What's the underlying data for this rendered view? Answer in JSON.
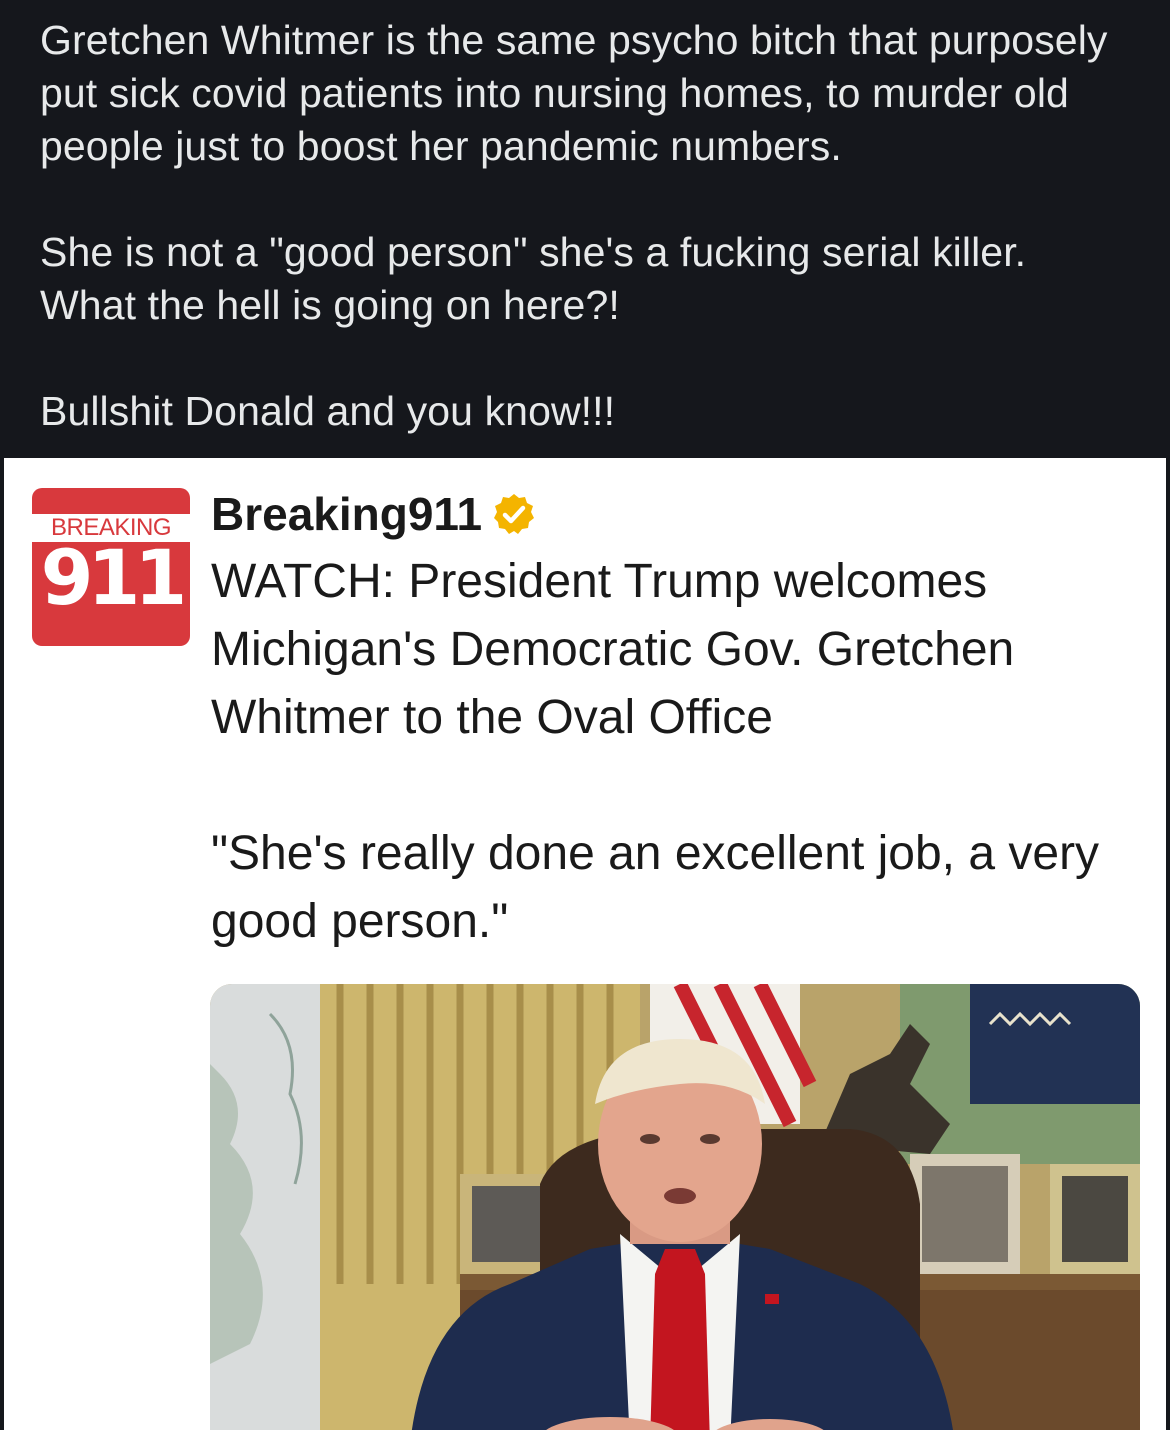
{
  "post": {
    "paragraph1": "Gretchen Whitmer is the same psycho bitch that purposely put sick covid patients into nursing homes, to murder old people just to boost her pandemic numbers.",
    "paragraph2_line1": "She is not a \"good person\" she's a fucking serial killer.",
    "paragraph2_line2": "What the hell is going on here?!",
    "paragraph3": "Bullshit Donald and you know!!!"
  },
  "embedded_tweet": {
    "logo_top_text": "BREAKING",
    "logo_number": "911",
    "handle": "Breaking911",
    "verified_icon": "verified-badge-icon",
    "verified_color": "#f4b400",
    "headline": "WATCH: President Trump welcomes Michigan's Democratic Gov. Gretchen Whitmer to the Oval Office",
    "quote": "\"She's really done an excellent job, a very good person.\"",
    "photo_icon": "oval-office-photo"
  },
  "colors": {
    "page_background": "#15171c",
    "post_text": "#e7e9ea",
    "logo_red": "#d8393d"
  }
}
